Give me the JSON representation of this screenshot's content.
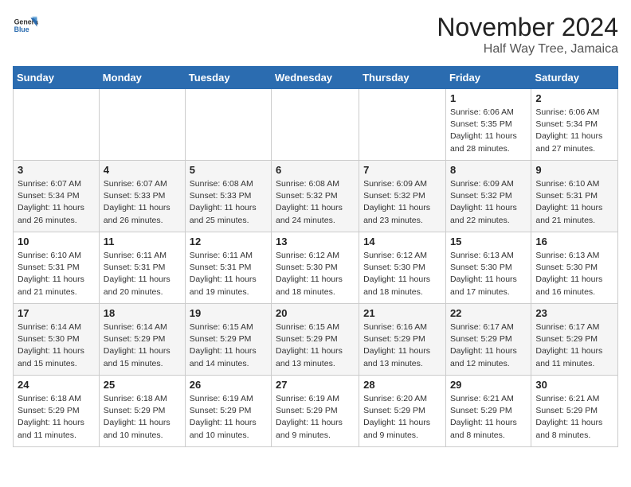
{
  "logo": {
    "line1": "General",
    "line2": "Blue"
  },
  "title": "November 2024",
  "subtitle": "Half Way Tree, Jamaica",
  "days_of_week": [
    "Sunday",
    "Monday",
    "Tuesday",
    "Wednesday",
    "Thursday",
    "Friday",
    "Saturday"
  ],
  "weeks": [
    [
      {
        "day": "",
        "info": ""
      },
      {
        "day": "",
        "info": ""
      },
      {
        "day": "",
        "info": ""
      },
      {
        "day": "",
        "info": ""
      },
      {
        "day": "",
        "info": ""
      },
      {
        "day": "1",
        "info": "Sunrise: 6:06 AM\nSunset: 5:35 PM\nDaylight: 11 hours and 28 minutes."
      },
      {
        "day": "2",
        "info": "Sunrise: 6:06 AM\nSunset: 5:34 PM\nDaylight: 11 hours and 27 minutes."
      }
    ],
    [
      {
        "day": "3",
        "info": "Sunrise: 6:07 AM\nSunset: 5:34 PM\nDaylight: 11 hours and 26 minutes."
      },
      {
        "day": "4",
        "info": "Sunrise: 6:07 AM\nSunset: 5:33 PM\nDaylight: 11 hours and 26 minutes."
      },
      {
        "day": "5",
        "info": "Sunrise: 6:08 AM\nSunset: 5:33 PM\nDaylight: 11 hours and 25 minutes."
      },
      {
        "day": "6",
        "info": "Sunrise: 6:08 AM\nSunset: 5:32 PM\nDaylight: 11 hours and 24 minutes."
      },
      {
        "day": "7",
        "info": "Sunrise: 6:09 AM\nSunset: 5:32 PM\nDaylight: 11 hours and 23 minutes."
      },
      {
        "day": "8",
        "info": "Sunrise: 6:09 AM\nSunset: 5:32 PM\nDaylight: 11 hours and 22 minutes."
      },
      {
        "day": "9",
        "info": "Sunrise: 6:10 AM\nSunset: 5:31 PM\nDaylight: 11 hours and 21 minutes."
      }
    ],
    [
      {
        "day": "10",
        "info": "Sunrise: 6:10 AM\nSunset: 5:31 PM\nDaylight: 11 hours and 21 minutes."
      },
      {
        "day": "11",
        "info": "Sunrise: 6:11 AM\nSunset: 5:31 PM\nDaylight: 11 hours and 20 minutes."
      },
      {
        "day": "12",
        "info": "Sunrise: 6:11 AM\nSunset: 5:31 PM\nDaylight: 11 hours and 19 minutes."
      },
      {
        "day": "13",
        "info": "Sunrise: 6:12 AM\nSunset: 5:30 PM\nDaylight: 11 hours and 18 minutes."
      },
      {
        "day": "14",
        "info": "Sunrise: 6:12 AM\nSunset: 5:30 PM\nDaylight: 11 hours and 18 minutes."
      },
      {
        "day": "15",
        "info": "Sunrise: 6:13 AM\nSunset: 5:30 PM\nDaylight: 11 hours and 17 minutes."
      },
      {
        "day": "16",
        "info": "Sunrise: 6:13 AM\nSunset: 5:30 PM\nDaylight: 11 hours and 16 minutes."
      }
    ],
    [
      {
        "day": "17",
        "info": "Sunrise: 6:14 AM\nSunset: 5:30 PM\nDaylight: 11 hours and 15 minutes."
      },
      {
        "day": "18",
        "info": "Sunrise: 6:14 AM\nSunset: 5:29 PM\nDaylight: 11 hours and 15 minutes."
      },
      {
        "day": "19",
        "info": "Sunrise: 6:15 AM\nSunset: 5:29 PM\nDaylight: 11 hours and 14 minutes."
      },
      {
        "day": "20",
        "info": "Sunrise: 6:15 AM\nSunset: 5:29 PM\nDaylight: 11 hours and 13 minutes."
      },
      {
        "day": "21",
        "info": "Sunrise: 6:16 AM\nSunset: 5:29 PM\nDaylight: 11 hours and 13 minutes."
      },
      {
        "day": "22",
        "info": "Sunrise: 6:17 AM\nSunset: 5:29 PM\nDaylight: 11 hours and 12 minutes."
      },
      {
        "day": "23",
        "info": "Sunrise: 6:17 AM\nSunset: 5:29 PM\nDaylight: 11 hours and 11 minutes."
      }
    ],
    [
      {
        "day": "24",
        "info": "Sunrise: 6:18 AM\nSunset: 5:29 PM\nDaylight: 11 hours and 11 minutes."
      },
      {
        "day": "25",
        "info": "Sunrise: 6:18 AM\nSunset: 5:29 PM\nDaylight: 11 hours and 10 minutes."
      },
      {
        "day": "26",
        "info": "Sunrise: 6:19 AM\nSunset: 5:29 PM\nDaylight: 11 hours and 10 minutes."
      },
      {
        "day": "27",
        "info": "Sunrise: 6:19 AM\nSunset: 5:29 PM\nDaylight: 11 hours and 9 minutes."
      },
      {
        "day": "28",
        "info": "Sunrise: 6:20 AM\nSunset: 5:29 PM\nDaylight: 11 hours and 9 minutes."
      },
      {
        "day": "29",
        "info": "Sunrise: 6:21 AM\nSunset: 5:29 PM\nDaylight: 11 hours and 8 minutes."
      },
      {
        "day": "30",
        "info": "Sunrise: 6:21 AM\nSunset: 5:29 PM\nDaylight: 11 hours and 8 minutes."
      }
    ]
  ]
}
